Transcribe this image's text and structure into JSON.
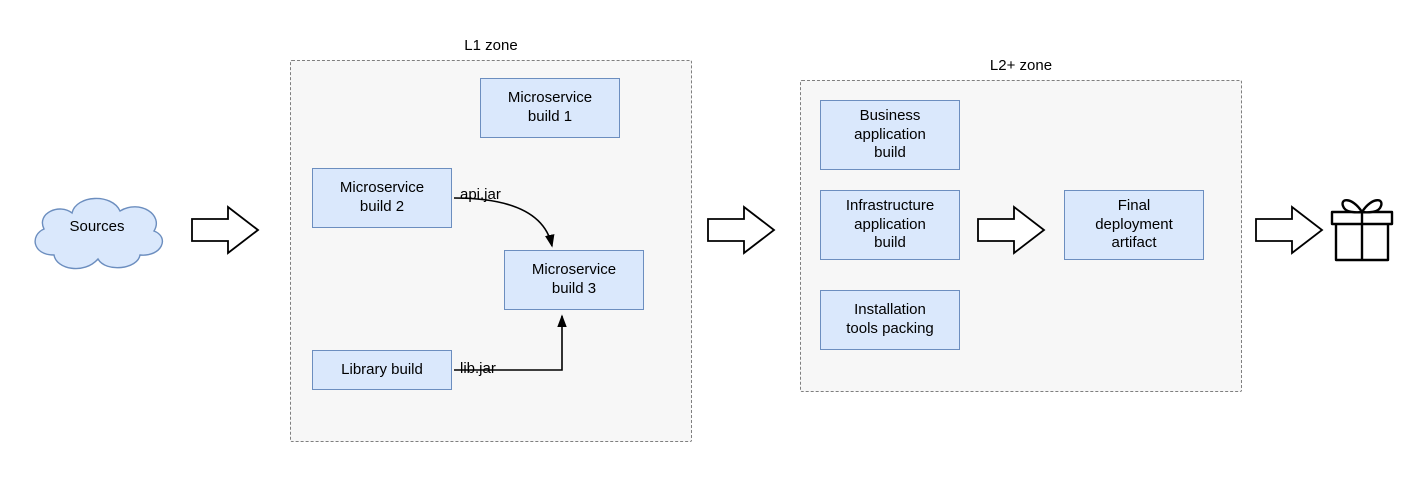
{
  "cloud": {
    "label": "Sources"
  },
  "zone1": {
    "title": "L1 zone",
    "box_ms1": "Microservice\nbuild 1",
    "box_ms2": "Microservice\nbuild 2",
    "box_ms3": "Microservice\nbuild 3",
    "box_lib": "Library build",
    "edge_api": "api.jar",
    "edge_lib": "lib.jar"
  },
  "zone2": {
    "title": "L2+ zone",
    "box_biz": "Business\napplication\nbuild",
    "box_infra": "Infrastructure\napplication\nbuild",
    "box_install": "Installation\ntools packing",
    "box_final": "Final\ndeployment\nartifact"
  }
}
